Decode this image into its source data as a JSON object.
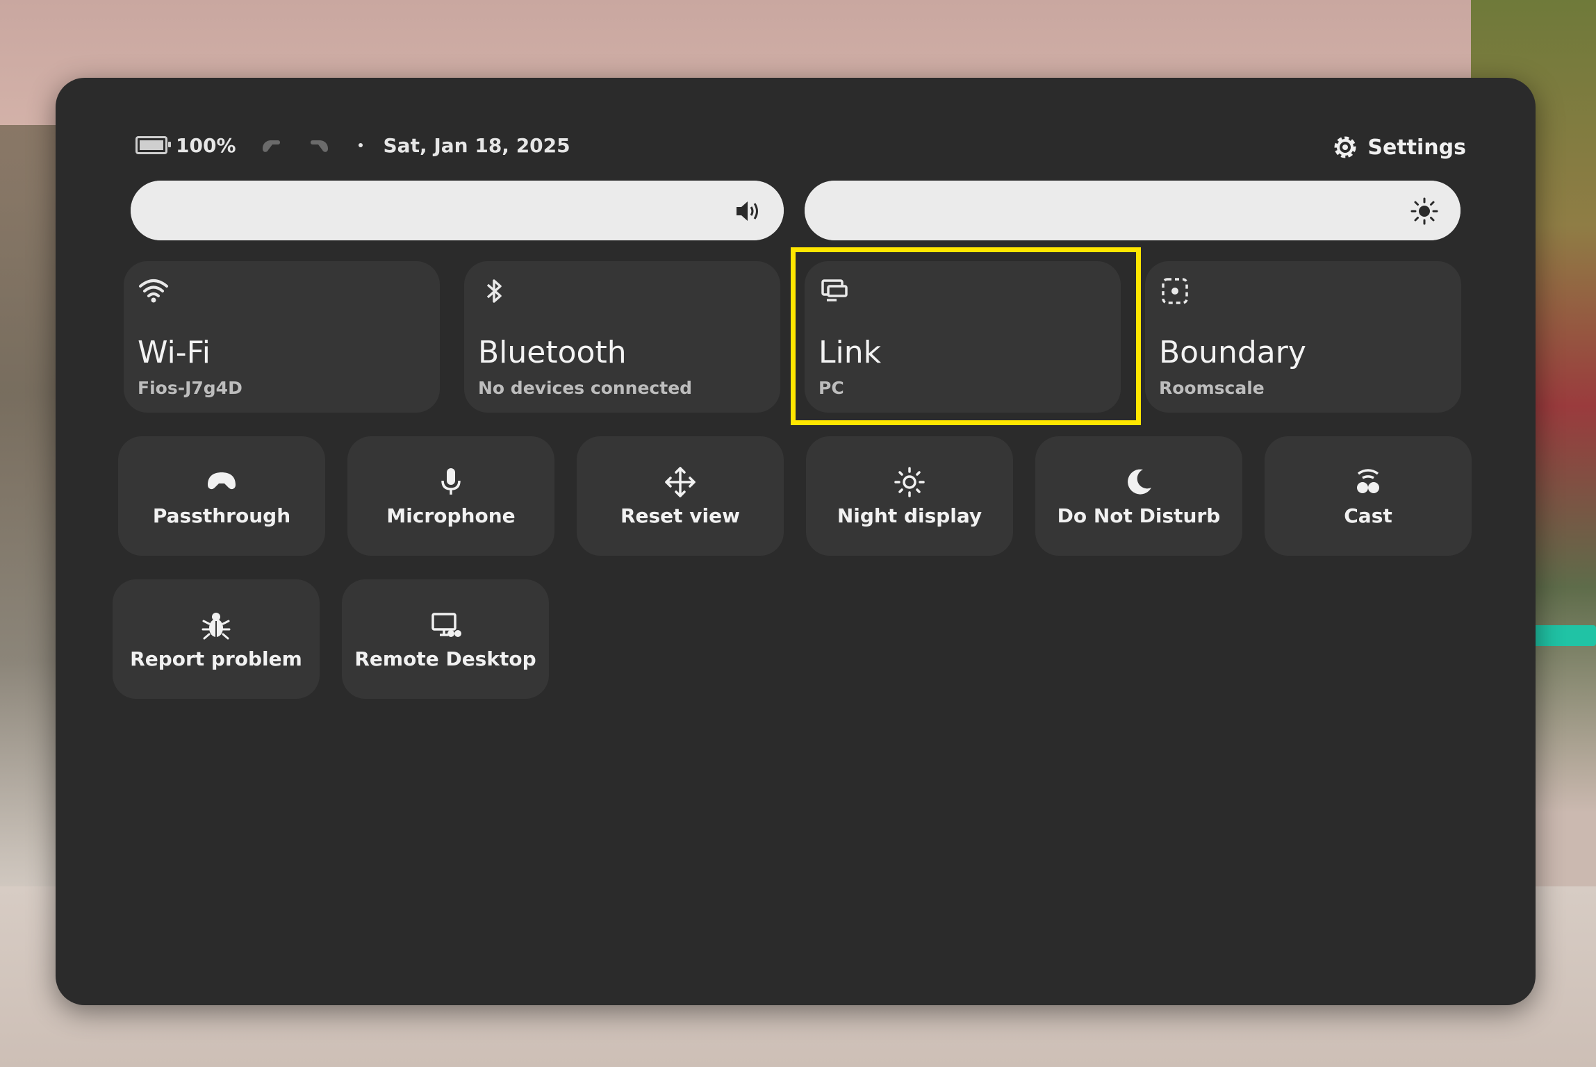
{
  "status_bar": {
    "battery": "100%",
    "date": "Sat, Jan 18, 2025"
  },
  "header": {
    "settings_label": "Settings"
  },
  "sliders": {
    "volume_level": 1.0,
    "brightness_level": 1.0
  },
  "large_tiles": [
    {
      "title": "Wi-Fi",
      "subtitle": "Fios-J7g4D",
      "icon": "wifi-icon"
    },
    {
      "title": "Bluetooth",
      "subtitle": "No devices connected",
      "icon": "bluetooth-icon"
    },
    {
      "title": "Link",
      "subtitle": "PC",
      "icon": "link-icon"
    },
    {
      "title": "Boundary",
      "subtitle": "Roomscale",
      "icon": "boundary-icon"
    }
  ],
  "small_tiles": [
    {
      "label": "Passthrough",
      "icon": "passthrough-icon"
    },
    {
      "label": "Microphone",
      "icon": "microphone-icon"
    },
    {
      "label": "Reset view",
      "icon": "move-icon"
    },
    {
      "label": "Night display",
      "icon": "sun-icon"
    },
    {
      "label": "Do Not Disturb",
      "icon": "moon-icon"
    },
    {
      "label": "Cast",
      "icon": "cast-icon"
    },
    {
      "label": "Report problem",
      "icon": "bug-icon"
    },
    {
      "label": "Remote Desktop",
      "icon": "remote-desktop-icon"
    }
  ],
  "highlight_color": "#ffe600"
}
